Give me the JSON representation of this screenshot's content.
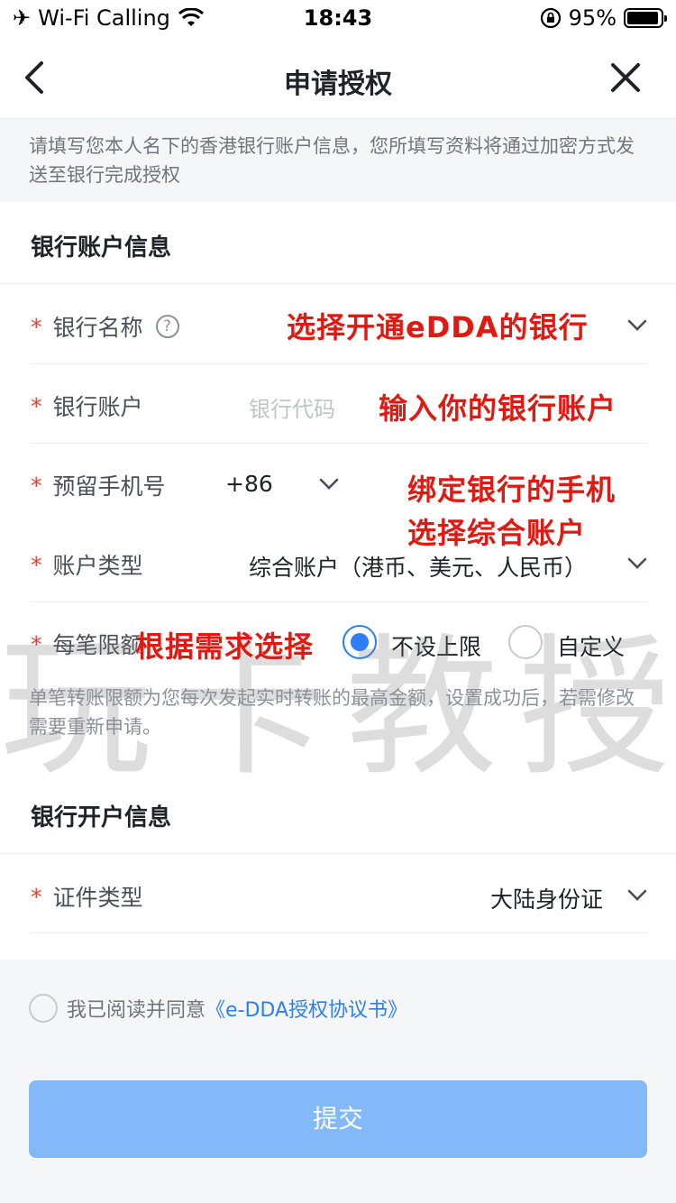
{
  "status_bar": {
    "carrier": "Wi-Fi Calling",
    "time": "18:43",
    "battery_percent": "95%",
    "battery_level": 0.95
  },
  "nav": {
    "title": "申请授权"
  },
  "notice": "请填写您本人名下的香港银行账户信息，您所填写资料将通过加密方式发送至银行完成授权",
  "bank_account_section": {
    "title": "银行账户信息",
    "bank_name": {
      "label": "银行名称",
      "help": "?"
    },
    "bank_account": {
      "label": "银行账户",
      "bank_code_placeholder": "银行代码"
    },
    "phone": {
      "label": "预留手机号",
      "country_code": "+86"
    },
    "account_type": {
      "label": "账户类型",
      "value": "综合账户（港币、美元、人民币）"
    },
    "limit": {
      "label": "每笔限额",
      "options": [
        "不设上限",
        "自定义"
      ],
      "selected": "不设上限"
    },
    "hint": "单笔转账限额为您每次发起实时转账的最高金额，设置成功后，若需修改需要重新申请。"
  },
  "bank_open_section": {
    "title": "银行开户信息",
    "id_type": {
      "label": "证件类型",
      "value": "大陆身份证"
    }
  },
  "agreement": {
    "prefix": "我已阅读并同意",
    "link": "《e-DDA授权协议书》"
  },
  "submit_label": "提交",
  "annotations": {
    "a1": "选择开通eDDA的银行",
    "a2": "输入你的银行账户",
    "a3": "绑定银行的手机",
    "a4": "选择综合账户",
    "a5": "根据需求选择"
  },
  "watermark": "玩卡教授",
  "colors": {
    "accent": "#2c7ef8",
    "required": "#e5423c",
    "annotation": "#e01a12",
    "submit_disabled": "#83b8f9"
  }
}
